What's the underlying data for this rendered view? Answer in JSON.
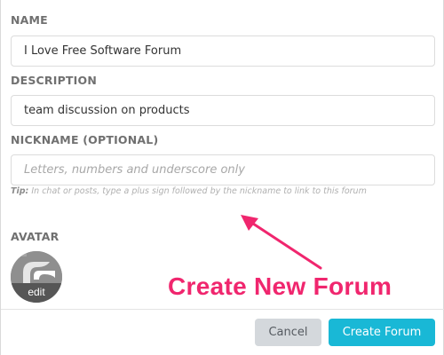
{
  "form": {
    "name": {
      "label": "NAME",
      "value": "I Love Free Software Forum"
    },
    "description": {
      "label": "DESCRIPTION",
      "value": "team discussion on products"
    },
    "nickname": {
      "label": "NICKNAME (OPTIONAL)",
      "value": "",
      "placeholder": "Letters, numbers and underscore only",
      "tip_prefix": "Tip:",
      "tip_text": " In chat or posts, type a plus sign followed by the nickname to link to this forum"
    },
    "avatar": {
      "label": "AVATAR",
      "edit_label": "edit"
    }
  },
  "buttons": {
    "cancel": "Cancel",
    "create": "Create Forum"
  },
  "annotation": {
    "text": "Create New Forum",
    "color": "#f0266e"
  },
  "colors": {
    "primary": "#19b8d6",
    "cancel_bg": "#d4d8dc",
    "label": "#707070"
  }
}
